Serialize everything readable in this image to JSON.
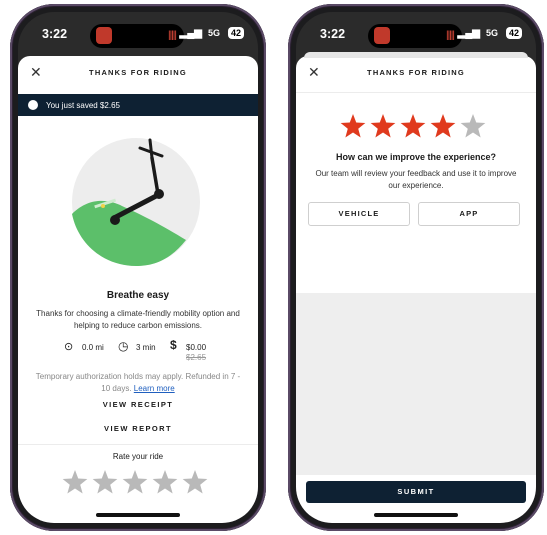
{
  "colors": {
    "navy": "#0e2133",
    "star_red": "#e03a1e",
    "star_grey": "#b9b9b9",
    "green": "#5cbf6a"
  },
  "status": {
    "time": "3:22",
    "network": "5G",
    "battery": "42"
  },
  "left": {
    "title": "THANKS FOR RIDING",
    "banner": "You just saved $2.65",
    "heading": "Breathe easy",
    "body": "Thanks for choosing a climate-friendly mobility option and helping to reduce carbon emissions.",
    "distance": "0.0 mi",
    "duration": "3 min",
    "price": "$0.00",
    "price_original": "$2.65",
    "note": "Temporary authorization holds may apply. Refunded in 7 - 10 days.",
    "learn_more": "Learn more",
    "view_receipt": "VIEW RECEIPT",
    "view_report": "VIEW REPORT",
    "rate_label": "Rate your ride",
    "rating": 0,
    "rating_max": 5
  },
  "right": {
    "title": "THANKS FOR RIDING",
    "rating": 4,
    "rating_max": 5,
    "question": "How can we improve the experience?",
    "subtext": "Our team will review your feedback and use it to improve our experience.",
    "option_vehicle": "VEHICLE",
    "option_app": "APP",
    "submit": "SUBMIT"
  }
}
